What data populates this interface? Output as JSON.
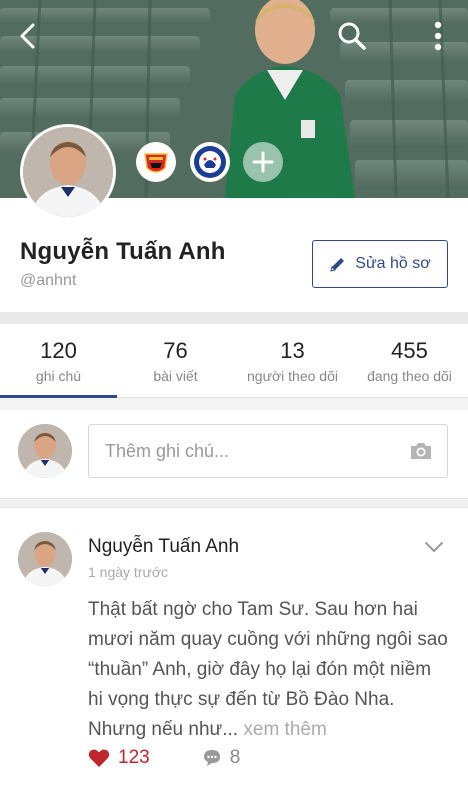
{
  "header": {
    "back_icon": "back-chevron-icon",
    "search_icon": "search-icon",
    "menu_icon": "more-vertical-icon"
  },
  "profile": {
    "name": "Nguyễn Tuấn Anh",
    "handle": "@anhnt",
    "edit_label": "Sửa hồ sơ",
    "clubs": [
      "manchester-united-badge",
      "chelsea-badge"
    ],
    "add_club_icon": "plus-icon"
  },
  "stats": [
    {
      "num": "120",
      "label": "ghi chú"
    },
    {
      "num": "76",
      "label": "bài viết"
    },
    {
      "num": "13",
      "label": "người theo dõi"
    },
    {
      "num": "455",
      "label": "đang theo dõi"
    }
  ],
  "compose": {
    "placeholder": "Thêm ghi chú..."
  },
  "post": {
    "author": "Nguyễn Tuấn Anh",
    "time": "1 ngày trước",
    "body": "Thật bất ngờ cho Tam Sư. Sau hơn hai mươi năm quay cuồng với những ngôi sao “thuần” Anh, giờ đây họ lại đón một niềm hi vọng thực sự đến từ Bồ Đào Nha. Nhưng nếu như...",
    "more": "xem thêm",
    "likes": "123",
    "comments": "8"
  },
  "colors": {
    "accent": "#2f4a8a",
    "like": "#c0272d"
  }
}
